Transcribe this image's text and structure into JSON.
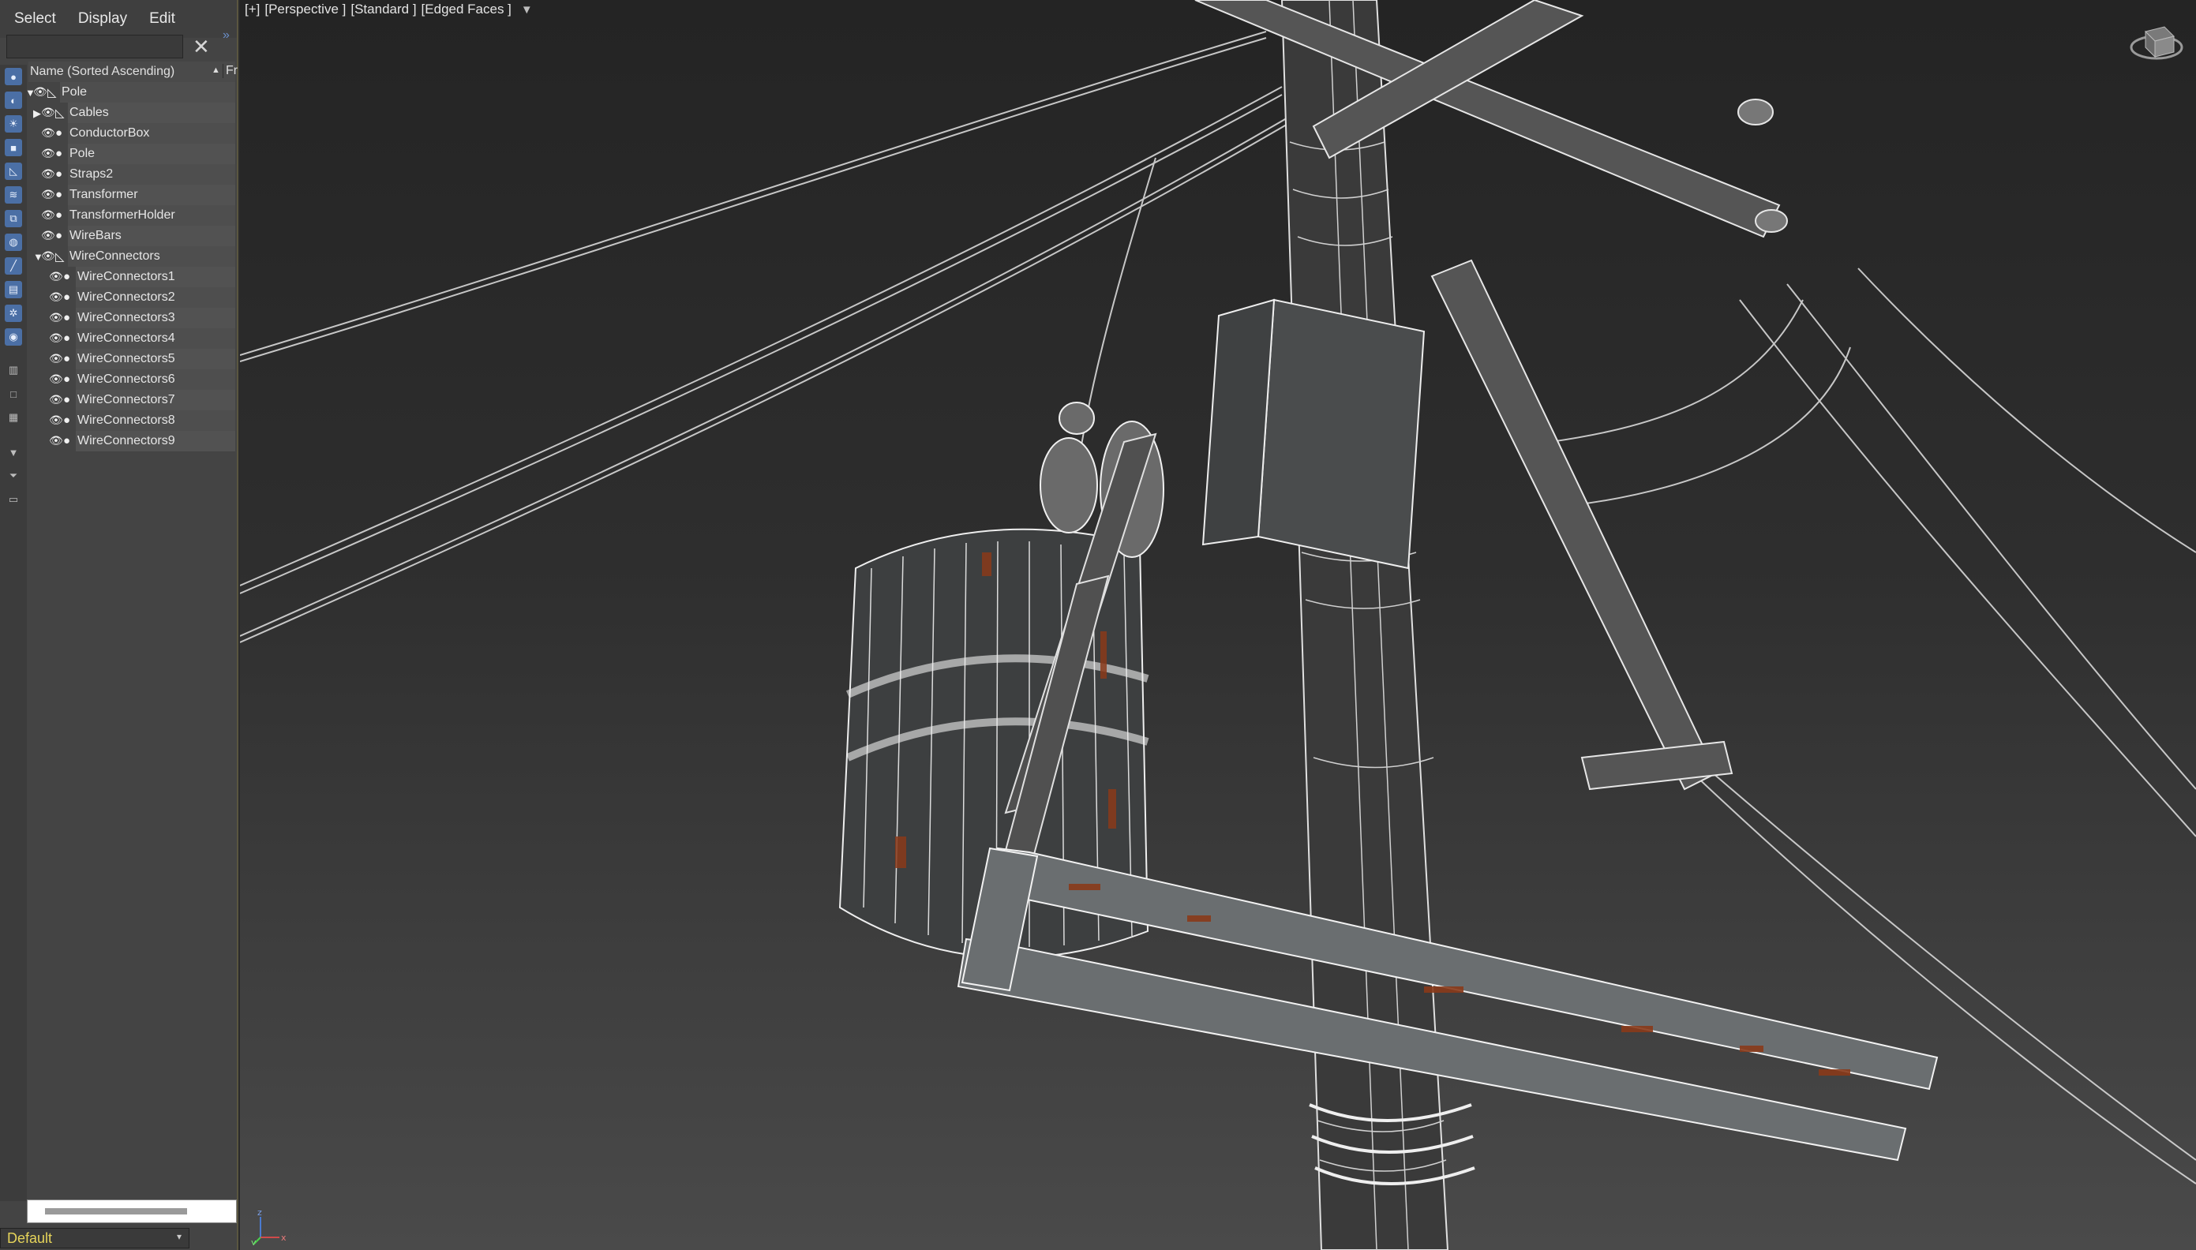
{
  "menu": {
    "select": "Select",
    "display": "Display",
    "edit": "Edit"
  },
  "search": {
    "value": "",
    "placeholder": ""
  },
  "tree": {
    "header": "Name (Sorted Ascending)",
    "col2": "Fr",
    "items": [
      {
        "label": "Pole",
        "level": 0,
        "expanded": true,
        "type": "group"
      },
      {
        "label": "Cables",
        "level": 1,
        "expanded": false,
        "type": "group"
      },
      {
        "label": "ConductorBox",
        "level": 1,
        "type": "object"
      },
      {
        "label": "Pole",
        "level": 1,
        "type": "object"
      },
      {
        "label": "Straps2",
        "level": 1,
        "type": "object"
      },
      {
        "label": "Transformer",
        "level": 1,
        "type": "object"
      },
      {
        "label": "TransformerHolder",
        "level": 1,
        "type": "object"
      },
      {
        "label": "WireBars",
        "level": 1,
        "type": "object"
      },
      {
        "label": "WireConnectors",
        "level": 1,
        "expanded": true,
        "type": "group"
      },
      {
        "label": "WireConnectors1",
        "level": 2,
        "type": "object"
      },
      {
        "label": "WireConnectors2",
        "level": 2,
        "type": "object"
      },
      {
        "label": "WireConnectors3",
        "level": 2,
        "type": "object"
      },
      {
        "label": "WireConnectors4",
        "level": 2,
        "type": "object"
      },
      {
        "label": "WireConnectors5",
        "level": 2,
        "type": "object"
      },
      {
        "label": "WireConnectors6",
        "level": 2,
        "type": "object"
      },
      {
        "label": "WireConnectors7",
        "level": 2,
        "type": "object"
      },
      {
        "label": "WireConnectors8",
        "level": 2,
        "type": "object"
      },
      {
        "label": "WireConnectors9",
        "level": 2,
        "type": "object"
      }
    ]
  },
  "viewport": {
    "plus": "[+]",
    "view": "[Perspective ]",
    "shading": "[Standard ]",
    "mode": "[Edged Faces ]"
  },
  "layer": {
    "value": "Default"
  },
  "colors": {
    "accent_blue": "#4b6fa5",
    "layer_text": "#e6d45a",
    "rust": "#8a3a1a"
  },
  "icons": [
    "eye-icon",
    "geometry-icon",
    "sphere-icon",
    "expand-arrow-icon",
    "close-icon",
    "filter-icon",
    "viewcube-icon",
    "axis-tripod-icon"
  ]
}
